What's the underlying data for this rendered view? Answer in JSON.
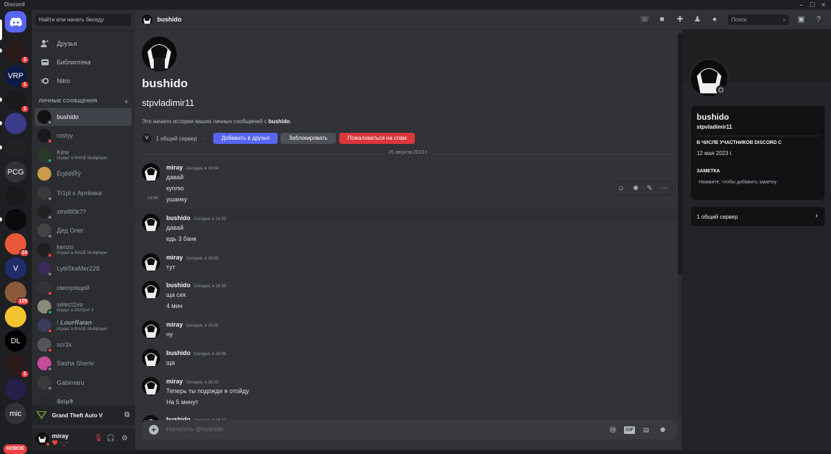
{
  "window": {
    "title": "Discord",
    "controls": [
      "–",
      "☐",
      "✕"
    ]
  },
  "rail": {
    "servers": [
      {
        "initials": "",
        "badge": "3",
        "color": "#2b1a1a"
      },
      {
        "initials": "VRP",
        "badge": "1",
        "color": "#0c1a45"
      },
      {
        "initials": "",
        "badge": "1",
        "color": "#1a1a1a"
      },
      {
        "initials": "",
        "badge": "",
        "color": "#3d3b8c"
      },
      {
        "initials": "",
        "badge": "",
        "color": "#222"
      },
      {
        "initials": "PCG",
        "badge": "",
        "color": "#313338"
      },
      {
        "initials": "",
        "badge": "",
        "color": "#1a1a1a"
      },
      {
        "initials": "",
        "badge": "",
        "color": "#0a0a0a"
      },
      {
        "initials": "",
        "badge": "14",
        "color": "#e8583a"
      },
      {
        "initials": "V",
        "badge": "",
        "color": "#1f2d6b"
      },
      {
        "initials": "",
        "badge": "125",
        "color": "#8a5a3a"
      },
      {
        "initials": "",
        "badge": "",
        "color": "#f4c430"
      },
      {
        "initials": "DL",
        "badge": "",
        "color": "#000000"
      },
      {
        "initials": "",
        "badge": "1",
        "color": "#2a1a1a"
      },
      {
        "initials": "",
        "badge": "",
        "color": "#24204a"
      },
      {
        "initials": "mic",
        "badge": "",
        "color": "#313338"
      }
    ],
    "new_label": "НОВОЕ"
  },
  "sidebar": {
    "search_placeholder": "Найти или начать беседу",
    "nav": [
      {
        "label": "Друзья",
        "icon": "friends-icon"
      },
      {
        "label": "Библиотека",
        "icon": "library-icon"
      },
      {
        "label": "Nitro",
        "icon": "nitro-icon"
      }
    ],
    "dm_header": "ЛИЧНЫЕ СООБЩЕНИЯ",
    "dms": [
      {
        "name": "bushido",
        "sub": "",
        "status": "offline",
        "color": "#111111"
      },
      {
        "name": "roslyy",
        "sub": "",
        "status": "dnd",
        "color": "#1a1a1a"
      },
      {
        "name": "Kew",
        "sub": "Играет в RAGE Multiplayer",
        "status": "online",
        "color": "#2a3a2a"
      },
      {
        "name": "ÈŋêêtŘÿ",
        "sub": "",
        "status": "none",
        "color": "#c89a4a"
      },
      {
        "name": "Tr1pl x Артёмка",
        "sub": "",
        "status": "offline",
        "color": "#3a3a3a"
      },
      {
        "name": "strellll0k??",
        "sub": "",
        "status": "offline",
        "color": "#222222"
      },
      {
        "name": "Дед Олег",
        "sub": "",
        "status": "offline",
        "color": "#444444"
      },
      {
        "name": "kenzo",
        "sub": "Играет в RAGE Multiplayer",
        "status": "dnd",
        "color": "#1f1f1f"
      },
      {
        "name": "LytiiSkaMer228",
        "sub": "",
        "status": "offline",
        "color": "#3a2a5a"
      },
      {
        "name": "смотрящий",
        "sub": "",
        "status": "dnd",
        "color": "#333333"
      },
      {
        "name": "select1ve",
        "sub": "Играет в PAYDAY 2",
        "status": "online",
        "color": "#8a8a7a"
      },
      {
        "name": "! 𝑳𝒐𝒖𝒓𝑹𝒂𝒊𝒂𝒏",
        "sub": "Играет в RAGE Multiplayer",
        "status": "dnd",
        "color": "#3a3a5a"
      },
      {
        "name": "scr3x",
        "sub": "",
        "status": "dnd",
        "color": "#555555"
      },
      {
        "name": "Sasha Sheriv",
        "sub": "",
        "status": "offline",
        "color": "#c84a9a"
      },
      {
        "name": "Gabimaru",
        "sub": "",
        "status": "offline",
        "color": "#3a3a3a"
      },
      {
        "name": "𝕾𝖊𝖎𝖟𝖊𝖉",
        "sub": "",
        "status": "offline",
        "color": "#2a2a2a"
      }
    ],
    "activity": "Grand Theft Auto V",
    "user": {
      "name": "miray",
      "status": "❤️ ¬_¬"
    }
  },
  "header": {
    "title": "bushido",
    "search_placeholder": "Поиск"
  },
  "intro": {
    "name": "bushido",
    "username": "stpvladimir11",
    "text_prefix": "Это начало истории ваших личных сообщений с ",
    "text_name": "bushido",
    "text_suffix": ".",
    "mutual": "1 общий сервер",
    "mutual_initial": "V",
    "btn_add": "Добавить в друзья",
    "btn_block": "Заблокировать",
    "btn_spam": "Пожаловаться на спам",
    "colors": {
      "add": "#5865f2",
      "block": "#4e5058",
      "spam": "#da373c"
    }
  },
  "date_divider": "25 августа 2023 г.",
  "messages": [
    {
      "author": "miray",
      "time": "Сегодня, в 16:04",
      "lines": [
        "давай",
        "куплю",
        "ушанку"
      ],
      "stamp": "16:04"
    },
    {
      "author": "bushido",
      "time": "Сегодня, в 16:05",
      "lines": [
        "давай",
        "едь 3 банк"
      ]
    },
    {
      "author": "miray",
      "time": "Сегодня, в 16:05",
      "lines": [
        "тут"
      ]
    },
    {
      "author": "bushido",
      "time": "Сегодня, в 16:06",
      "lines": [
        "ща сек",
        "4 мин"
      ]
    },
    {
      "author": "miray",
      "time": "Сегодня, в 16:08",
      "lines": [
        "ну"
      ]
    },
    {
      "author": "bushido",
      "time": "Сегодня, в 16:08",
      "lines": [
        "ща"
      ]
    },
    {
      "author": "miray",
      "time": "Сегодня, в 16:10",
      "lines": [
        "Теперь ты подожди я отойду",
        "На 5 минут"
      ]
    },
    {
      "author": "bushido",
      "time": "Сегодня, в 16:10",
      "lines": []
    }
  ],
  "composer": {
    "placeholder": "Написать @bushido",
    "gif": "GIF"
  },
  "profile": {
    "name": "bushido",
    "username": "stpvladimir11",
    "member_since_label": "В ЧИСЛЕ УЧАСТНИКОВ DISCORD С",
    "member_since": "12 мая 2023 г.",
    "note_label": "ЗАМЕТКА",
    "note_placeholder": "Нажмите, чтобы добавить заметку",
    "mutual": "1 общий сервер"
  }
}
